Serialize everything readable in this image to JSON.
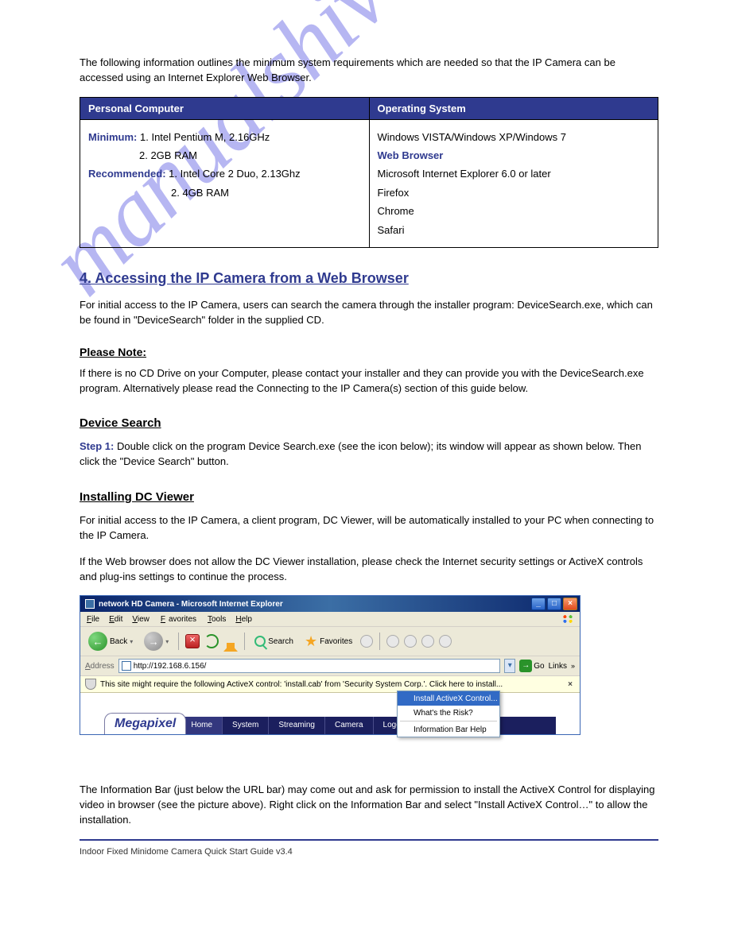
{
  "watermark": "manualshive.com",
  "intro_para": "The following information outlines the minimum system requirements which are needed so that the IP Camera can be accessed using an Internet Explorer Web Browser.",
  "table": {
    "header_left": "Personal Computer",
    "header_right": "Operating System",
    "left_rows": [
      {
        "label": "Minimum:",
        "value": "1. Intel Pentium M, 2.16GHz"
      },
      {
        "gap": true,
        "value": "2. 2GB RAM"
      },
      {
        "label": "Recommended:",
        "value": "1. Intel Core 2 Duo, 2.13Ghz"
      },
      {
        "gap": true,
        "value": "2. 4GB RAM"
      }
    ],
    "right_rows": [
      "Windows VISTA/Windows XP/Windows 7",
      "Web Browser",
      "Microsoft Internet Explorer 6.0 or later",
      "Firefox",
      "Chrome",
      "Safari"
    ]
  },
  "section4": {
    "title": "4. Accessing the IP Camera from a Web Browser",
    "para": "For initial access to the IP Camera, users can search the camera through the installer program: DeviceSearch.exe, which can be found in \"DeviceSearch\" folder in the supplied CD.",
    "note_title": "Please Note:",
    "note_body": "If there is no CD Drive on your Computer, please contact your installer and they can provide you with the DeviceSearch.exe program. Alternatively please read the Connecting to the IP Camera(s) section of this guide below."
  },
  "device_search": {
    "title": "Device Search",
    "step1": {
      "label": "Step 1:",
      "text": "Double click on the program Device Search.exe (see the icon below); its window will appear as shown below. Then click the \"Device Search\" button."
    }
  },
  "activex": {
    "title": "Installing DC Viewer",
    "para": "For initial access to the IP Camera, a client program, DC Viewer, will be automatically installed to your PC when connecting to the IP Camera.",
    "note": "If the Web browser does not allow the DC Viewer installation, please check the Internet security settings or ActiveX controls and plug-ins settings to continue the process."
  },
  "ie": {
    "title": "network HD Camera - Microsoft Internet Explorer",
    "menu": [
      "File",
      "Edit",
      "View",
      "Favorites",
      "Tools",
      "Help"
    ],
    "back": "Back",
    "search": "Search",
    "favorites": "Favorites",
    "address_label": "Address",
    "address_value": "http://192.168.6.156/",
    "go": "Go",
    "links": "Links",
    "infobar": "This site might require the following ActiveX control: 'install.cab' from 'Security System Corp.'. Click here to install...",
    "info_menu": {
      "install": "Install ActiveX Control...",
      "risk": "What's the Risk?",
      "help": "Information Bar Help"
    },
    "logo": "Megapixel",
    "tabs": [
      "Home",
      "System",
      "Streaming",
      "Camera",
      "Logout"
    ]
  },
  "final_para": "The Information Bar (just below the URL bar) may come out and ask for permission to install the ActiveX Control for displaying video in browser (see the picture above). Right click on the Information Bar and select \"Install ActiveX Control…\" to allow the installation.",
  "footer": "Indoor Fixed Minidome Camera Quick Start Guide v3.4"
}
